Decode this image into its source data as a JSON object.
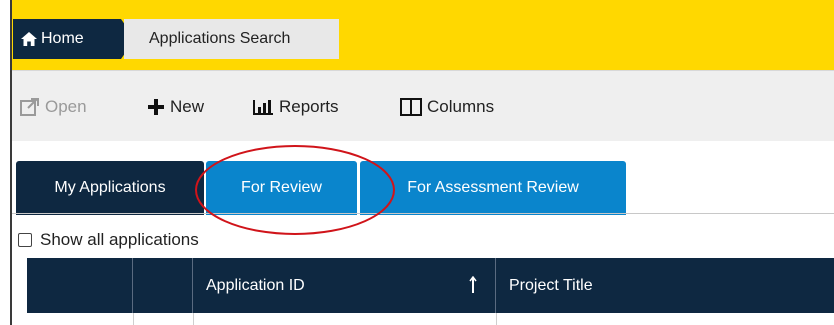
{
  "breadcrumb": {
    "home_label": "Home",
    "current_label": "Applications Search"
  },
  "toolbar": {
    "open_label": "Open",
    "new_label": "New",
    "reports_label": "Reports",
    "columns_label": "Columns"
  },
  "tabs": [
    {
      "label": "My Applications",
      "active": true
    },
    {
      "label": "For Review",
      "active": false
    },
    {
      "label": "For Assessment Review",
      "active": false
    }
  ],
  "filters": {
    "show_all_label": "Show all applications",
    "show_all_checked": false
  },
  "table": {
    "headers": [
      "",
      "",
      "Application ID",
      "Project Title"
    ],
    "sort_column": "Application ID",
    "sort_direction": "ascending"
  },
  "colors": {
    "topbar": "#ffd800",
    "navy": "#0e2841",
    "tab_blue": "#0a85cc",
    "annotation": "#d0141a"
  },
  "icons": {
    "home": "home-icon",
    "open": "external-link-icon",
    "new": "plus-icon",
    "reports": "bar-chart-icon",
    "columns": "columns-icon",
    "sort": "sort-arrow-up-icon"
  }
}
